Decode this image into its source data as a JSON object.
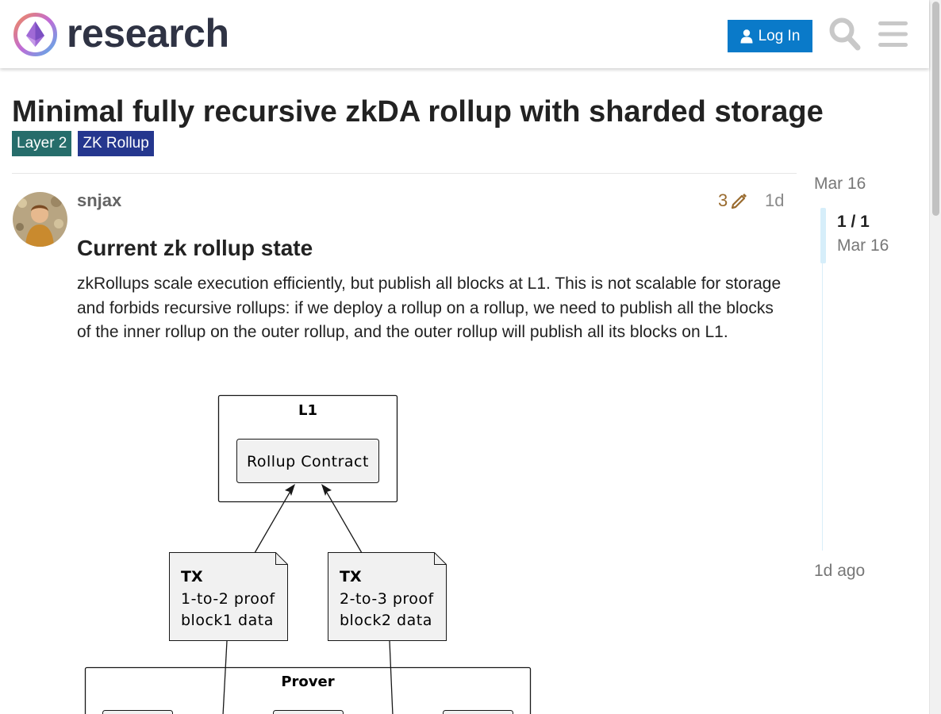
{
  "site": {
    "logo_text": "research",
    "login_label": "Log In"
  },
  "topic": {
    "title": "Minimal fully recursive zkDA rollup with sharded storage",
    "tags": [
      "Layer 2",
      "ZK Rollup"
    ],
    "tag_colors": [
      "#266d6b",
      "#25378e"
    ]
  },
  "post": {
    "author": "snjax",
    "edit_count": "3",
    "age": "1d",
    "heading": "Current zk rollup state",
    "body": "zkRollups scale execution efficiently, but publish all blocks at L1. This is not scalable for storage and forbids recursive rollups: if we deploy a rollup on a rollup, we need to publish all the blocks of the inner rollup on the outer rollup, and the outer rollup will publish all its blocks on L1."
  },
  "diagram": {
    "l1_label": "L1",
    "contract_label": "Rollup Contract",
    "tx1": {
      "title": "TX",
      "line1": "1-to-2 proof",
      "line2": "block1 data"
    },
    "tx2": {
      "title": "TX",
      "line1": "2-to-3 proof",
      "line2": "block2 data"
    },
    "prover_label": "Prover"
  },
  "timeline": {
    "start_date": "Mar 16",
    "position": "1 / 1",
    "current_date": "Mar 16",
    "end_label": "1d ago"
  },
  "colors": {
    "accent": "#0a7ac9",
    "edit_color": "#9a6c30"
  },
  "icons": [
    "user-icon",
    "search-icon",
    "hamburger-menu-icon",
    "pencil-icon"
  ]
}
